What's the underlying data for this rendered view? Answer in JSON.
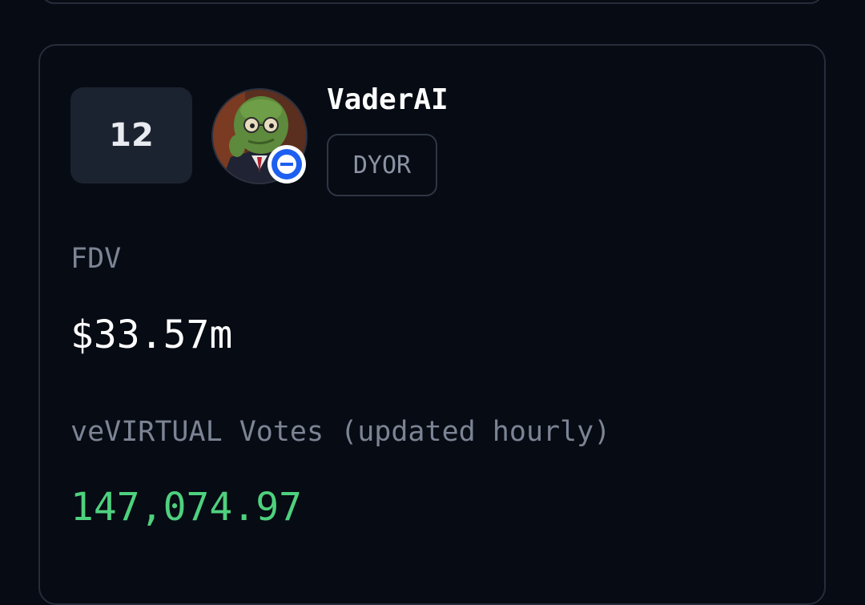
{
  "token": {
    "rank": "12",
    "name": "VaderAI",
    "tag": "DYOR",
    "avatar_icon": "pepe-avatar-icon",
    "chain_icon": "base-chain-icon"
  },
  "stats": {
    "fdv_label": "FDV",
    "fdv_value": "$33.57m",
    "votes_label": "veVIRTUAL Votes (updated hourly)",
    "votes_value": "147,074.97"
  },
  "colors": {
    "background": "#070b14",
    "card_border": "#262d3a",
    "rank_bg": "#1c2330",
    "label": "#7c8494",
    "votes_value": "#4ed17e",
    "chain_badge": "#1d5ff0"
  }
}
